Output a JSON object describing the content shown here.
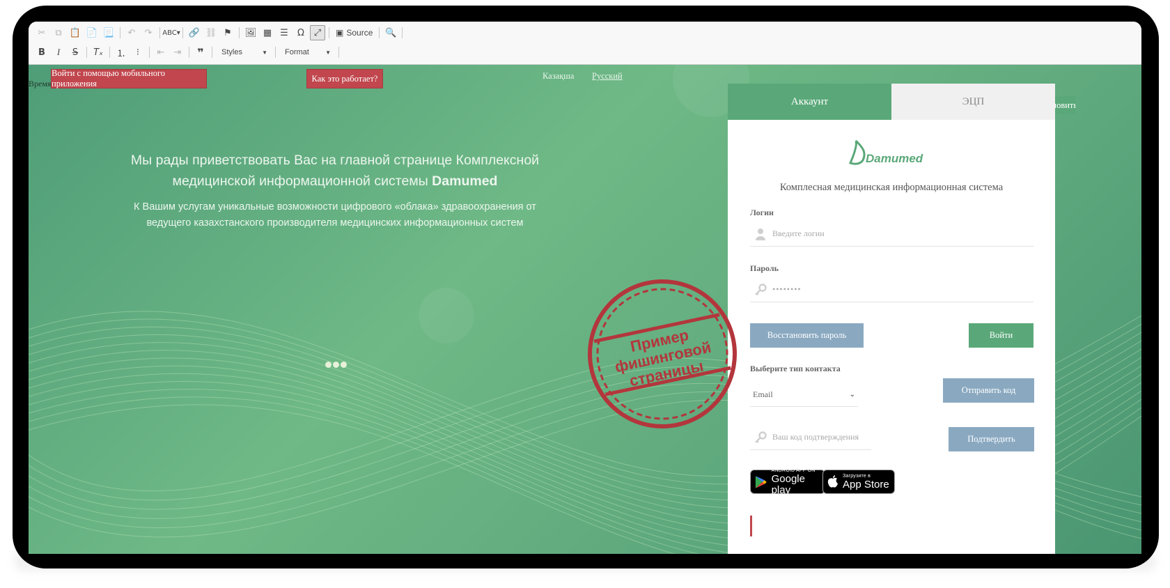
{
  "toolbar": {
    "source_label": "Source",
    "styles_label": "Styles",
    "format_label": "Format"
  },
  "page": {
    "time_label": "Время",
    "mobile_login_label": "Войти с помощью мобильного приложения",
    "how_it_works_label": "Как это работает?",
    "languages": [
      "Казақша",
      "Русский"
    ],
    "hero_title_main": "Мы рады приветствовать Вас на главной странице Комплексной медицинской информационной системы",
    "hero_title_brand": "Damumed",
    "hero_subtitle": "К Вашим услугам уникальные возможности цифрового «облака» здравоохранения от ведущего казахстанского производителя медицинских информационных систем",
    "refresh_label": "Обновить"
  },
  "login": {
    "tabs": [
      "Аккаунт",
      "ЭЦП"
    ],
    "logo_text": "Damumed",
    "system_name": "Комплесная медицинская информационная система",
    "login_label": "Логин",
    "login_placeholder": "Введите логин",
    "password_label": "Пароль",
    "password_value": "••••••••",
    "restore_label": "Восстановить пароль",
    "enter_label": "Войти",
    "contact_type_label": "Выберите тип контакта",
    "contact_type_value": "Email",
    "send_code_label": "Отправить код",
    "code_placeholder": "Ваш код подтверждения",
    "confirm_label": "Подтвердить",
    "google_play_small": "ANDROID APP ON",
    "google_play_big": "Google play",
    "app_store_small": "Загрузите в",
    "app_store_big": "App Store"
  },
  "stamp": {
    "line1": "Пример",
    "line2": "фишинговой",
    "line3": "страницы",
    "color": "#b3363c"
  },
  "colors": {
    "accent_green": "#5aa879",
    "button_blue": "#8aa9c1",
    "alert_red": "#c1464d"
  }
}
